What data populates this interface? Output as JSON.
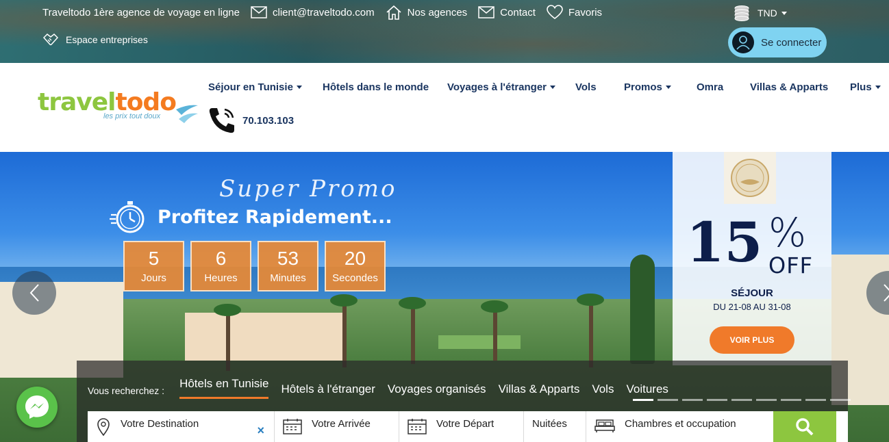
{
  "topbar": {
    "tagline": "Traveltodo 1ère agence de voyage en ligne",
    "email": "client@traveltodo.com",
    "agencies": "Nos agences",
    "contact": "Contact",
    "favorites": "Favoris",
    "business": "Espace entreprises",
    "currency": "TND",
    "connect": "Se connecter"
  },
  "logo": {
    "part1": "travel",
    "part2": "todo",
    "slogan": "les prix tout doux"
  },
  "nav": {
    "items": [
      {
        "label": "Séjour en Tunisie",
        "dropdown": true
      },
      {
        "label": "Hôtels dans le monde",
        "dropdown": false
      },
      {
        "label": "Voyages à l'étranger",
        "dropdown": true
      },
      {
        "label": "Vols",
        "dropdown": false
      },
      {
        "label": "Promos",
        "dropdown": true
      },
      {
        "label": "Omra",
        "dropdown": false
      },
      {
        "label": "Villas & Apparts",
        "dropdown": false
      },
      {
        "label": "Plus",
        "dropdown": true
      }
    ],
    "phone": "70.103.103"
  },
  "hero": {
    "script_title": "Super Promo",
    "title": "Profitez Rapidement...",
    "countdown": [
      {
        "value": "5",
        "label": "Jours"
      },
      {
        "value": "6",
        "label": "Heures"
      },
      {
        "value": "53",
        "label": "Minutes"
      },
      {
        "value": "20",
        "label": "Secondes"
      }
    ],
    "promo": {
      "percent": "15",
      "percent_sign": "%",
      "off": "OFF",
      "category": "SÉJOUR",
      "dates": "DU 21-08 AU 31-08",
      "cta": "VOIR PLUS"
    }
  },
  "search": {
    "lead": "Vous recherchez :",
    "tabs": [
      "Hôtels en Tunisie",
      "Hôtels à l'étranger",
      "Voyages organisés",
      "Villas & Apparts",
      "Vols",
      "Voitures"
    ],
    "active_tab": 0,
    "fields": {
      "destination": "Votre Destination",
      "arrival": "Votre Arrivée",
      "departure": "Votre Départ",
      "nights": "Nuitées",
      "rooms": "Chambres et occupation"
    },
    "clear": "×"
  },
  "colors": {
    "brand_green": "#8dc63f",
    "brand_orange": "#f47b20",
    "nav_blue": "#1a3560",
    "cta_orange": "#f07a2a",
    "connect_blue": "#7fd3f1"
  },
  "icons": [
    "mail-icon",
    "home-icon",
    "heart-icon",
    "handshake-icon",
    "coins-icon",
    "user-icon",
    "phone-icon",
    "stopwatch-icon",
    "chevron-left-icon",
    "chevron-right-icon",
    "map-pin-icon",
    "calendar-icon",
    "bed-icon",
    "search-icon",
    "messenger-icon"
  ]
}
